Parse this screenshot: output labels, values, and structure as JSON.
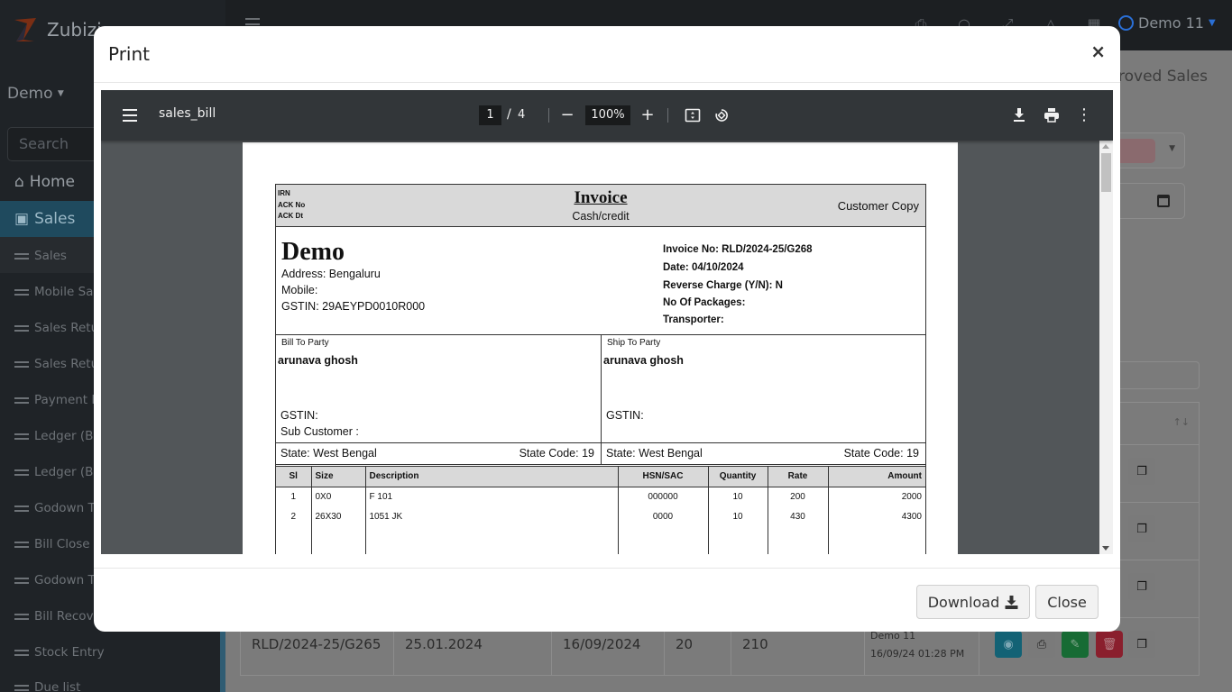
{
  "app": {
    "brand_name": "Zubizi",
    "user_name": "Demo 11",
    "company": "Demo",
    "search_placeholder": "Search",
    "page_heading_partial": "roved Sales",
    "nav": {
      "home": "Home",
      "sales": "Sales",
      "items": [
        "Sales",
        "Mobile Sal",
        "Sales Retu",
        "Sales Retu",
        "Payment R",
        "Ledger (Bi",
        "Ledger (Bu",
        "Godown Tr",
        "Bill Close",
        "Godown Tr",
        "Bill Recove",
        "Stock Entry",
        "Due list"
      ]
    },
    "table_row": {
      "invoice_no": "RLD/2024-25/G265",
      "bill_date": "25.01.2024",
      "entry_date": "16/09/2024",
      "qty": "20",
      "amount": "210",
      "created_by": "Demo 11",
      "created_at": "16/09/24 01:28 PM"
    },
    "colors": {
      "sales_active": "#1f4a5e",
      "view": "#136275",
      "edit": "#176b34",
      "delete": "#8a1f2d",
      "user_accent": "#2a6fd6"
    }
  },
  "modal": {
    "title": "Print",
    "close_glyph": "×",
    "download_label": "Download",
    "close_label": "Close"
  },
  "pdf": {
    "file_name": "sales_bill",
    "current_page": "1",
    "page_sep": "/",
    "total_pages": "4",
    "zoom": "100%",
    "invoice": {
      "irn_label": "IRN",
      "ack_no_label": "ACK No",
      "ack_dt_label": "ACK Dt",
      "title": "Invoice",
      "subtitle": "Cash/credit",
      "copy_type": "Customer Copy",
      "company_name": "Demo",
      "address": "Address: Bengaluru",
      "mobile": "Mobile:",
      "gstin": "GSTIN: 29AEYPD0010R000",
      "invoice_no": "Invoice No: RLD/2024-25/G268",
      "date": "Date: 04/10/2024",
      "reverse_charge": "Reverse Charge (Y/N): N",
      "packages": "No Of Packages:",
      "transporter": "Transporter:",
      "bill_to": {
        "label": "Bill To Party",
        "name": "arunava ghosh",
        "gstin": "GSTIN:",
        "sub_customer": "Sub Customer :",
        "state": "State:  West Bengal",
        "state_code": "State Code:  19"
      },
      "ship_to": {
        "label": "Ship To Party",
        "name": "arunava ghosh",
        "gstin": "GSTIN:",
        "state": "State:  West Bengal",
        "state_code": "State Code:  19"
      },
      "columns": [
        "Sl",
        "Size",
        "Description",
        "HSN/SAC",
        "Quantity",
        "Rate",
        "Amount"
      ],
      "rows": [
        [
          "1",
          "0X0",
          "F 101",
          "000000",
          "10",
          "200",
          "2000"
        ],
        [
          "2",
          "26X30",
          "1051 JK",
          "0000",
          "10",
          "430",
          "4300"
        ]
      ]
    }
  }
}
